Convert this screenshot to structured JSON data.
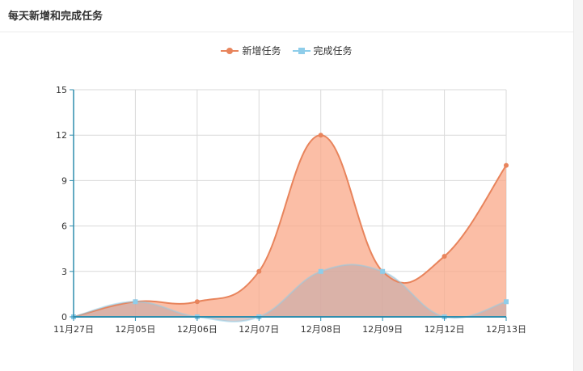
{
  "panel": {
    "title": "每天新增和完成任务"
  },
  "chart_data": {
    "type": "area",
    "categories": [
      "11月27日",
      "12月05日",
      "12月06日",
      "12月07日",
      "12月08日",
      "12月09日",
      "12月12日",
      "12月13日"
    ],
    "series": [
      {
        "name": "新增任务",
        "values": [
          0,
          1,
          1,
          3,
          12,
          3,
          4,
          10
        ],
        "color": "#e8845c",
        "fill": "#f9a888",
        "marker": "circle"
      },
      {
        "name": "完成任务",
        "values": [
          0,
          1,
          0,
          0,
          3,
          3,
          0,
          1
        ],
        "color": "#8ecdea",
        "fill": "#c5aaaa",
        "marker": "square"
      }
    ],
    "yticks": [
      0,
      3,
      6,
      9,
      12,
      15
    ],
    "ylim": [
      0,
      15
    ],
    "grid": true,
    "legend": "top-center",
    "axis_color": "#2f8dad"
  }
}
